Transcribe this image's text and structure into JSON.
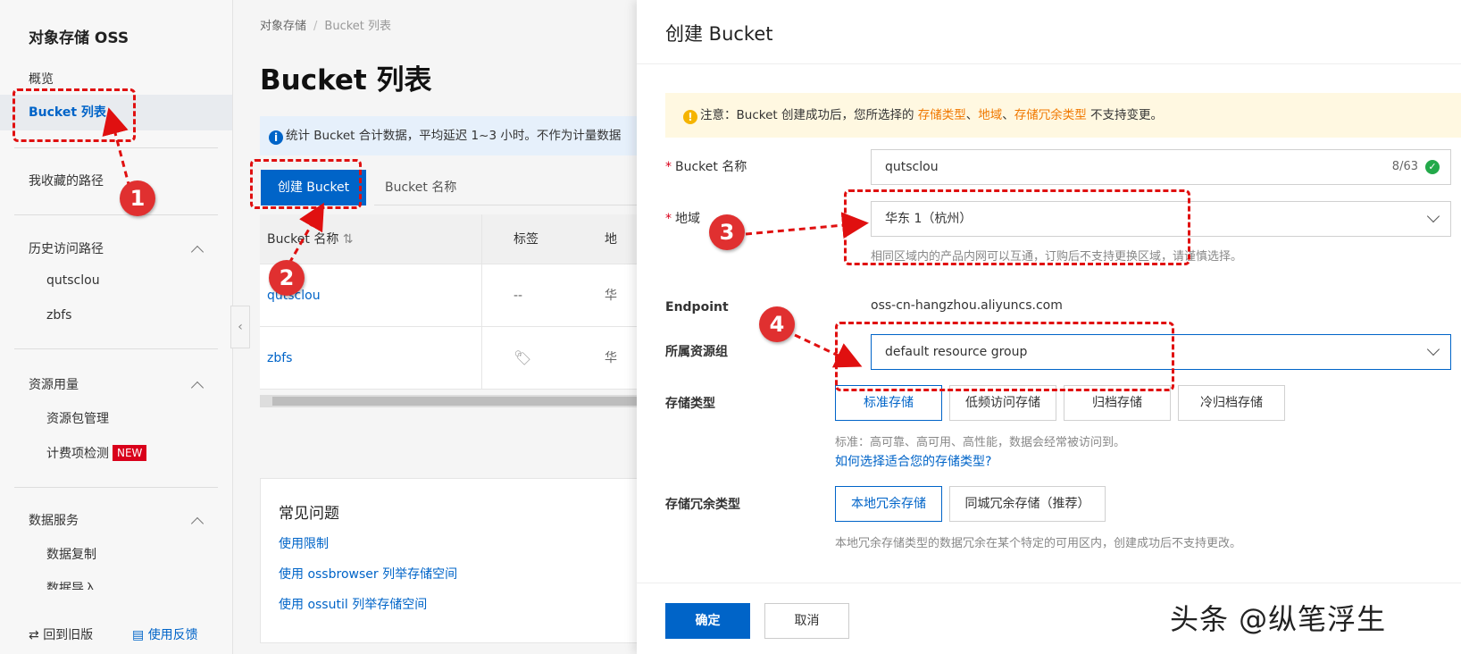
{
  "sidebar": {
    "title": "对象存储 OSS",
    "overview": "概览",
    "bucket_list": "Bucket 列表",
    "favorites": "我收藏的路径",
    "history": "历史访问路径",
    "history_items": [
      "qutsclou",
      "zbfs"
    ],
    "resource_usage": "资源用量",
    "resource_items": [
      "资源包管理",
      "计费项检测"
    ],
    "new_badge": "NEW",
    "data_services": "数据服务",
    "data_items": [
      "数据复制",
      "数据导入"
    ],
    "back_old": "回到旧版",
    "feedback": "使用反馈"
  },
  "main": {
    "breadcrumb": [
      "对象存储",
      "Bucket 列表"
    ],
    "page_title": "Bucket 列表",
    "notice": "统计 Bucket 合计数据，平均延迟 1~3 小时。不作为计量数据",
    "create_button": "创建 Bucket",
    "search_tab": "Bucket 名称",
    "table": {
      "headers": [
        "Bucket 名称",
        "标签",
        "地"
      ],
      "rows": [
        {
          "name": "qutsclou",
          "tag": "--",
          "region": "华"
        },
        {
          "name": "zbfs",
          "tag": "",
          "region": "华"
        }
      ]
    },
    "faq": {
      "title": "常见问题",
      "links": [
        "使用限制",
        "使用 ossbrowser 列举存储空间",
        "使用 ossutil 列举存储空间"
      ]
    }
  },
  "drawer": {
    "title": "创建 Bucket",
    "warning": {
      "prefix": "注意：Bucket 创建成功后，您所选择的 ",
      "k1": "存储类型",
      "sep1": "、",
      "k2": "地域",
      "sep2": "、",
      "k3": "存储冗余类型",
      "suffix": " 不支持变更。"
    },
    "bucket_name_label": "Bucket 名称",
    "bucket_name_value": "qutsclou",
    "bucket_name_count": "8/63",
    "region_label": "地域",
    "region_value": "华东 1（杭州）",
    "region_hint": "相同区域内的产品内网可以互通，订购后不支持更换区域，请谨慎选择。",
    "endpoint_label": "Endpoint",
    "endpoint_value": "oss-cn-hangzhou.aliyuncs.com",
    "resource_group_label": "所属资源组",
    "resource_group_value": "default resource group",
    "storage_type_label": "存储类型",
    "storage_types": [
      "标准存储",
      "低频访问存储",
      "归档存储",
      "冷归档存储"
    ],
    "storage_type_selected": "标准存储",
    "storage_hint": "标准：高可靠、高可用、高性能，数据会经常被访问到。",
    "storage_help_link": "如何选择适合您的存储类型?",
    "redundancy_label": "存储冗余类型",
    "redundancy_types": [
      "本地冗余存储",
      "同城冗余存储（推荐）"
    ],
    "redundancy_selected": "本地冗余存储",
    "redundancy_hint": "本地冗余存储类型的数据冗余在某个特定的可用区内，创建成功后不支持更改。",
    "ok_button": "确定",
    "cancel_button": "取消"
  },
  "annotations": [
    "1",
    "2",
    "3",
    "4"
  ],
  "watermark": "头条 @纵笔浮生",
  "colors": {
    "primary": "#0064c8",
    "annotation_red": "#e01010",
    "warning_orange": "#f07800",
    "new_badge": "#d9001b",
    "success_green": "#23a94a"
  }
}
